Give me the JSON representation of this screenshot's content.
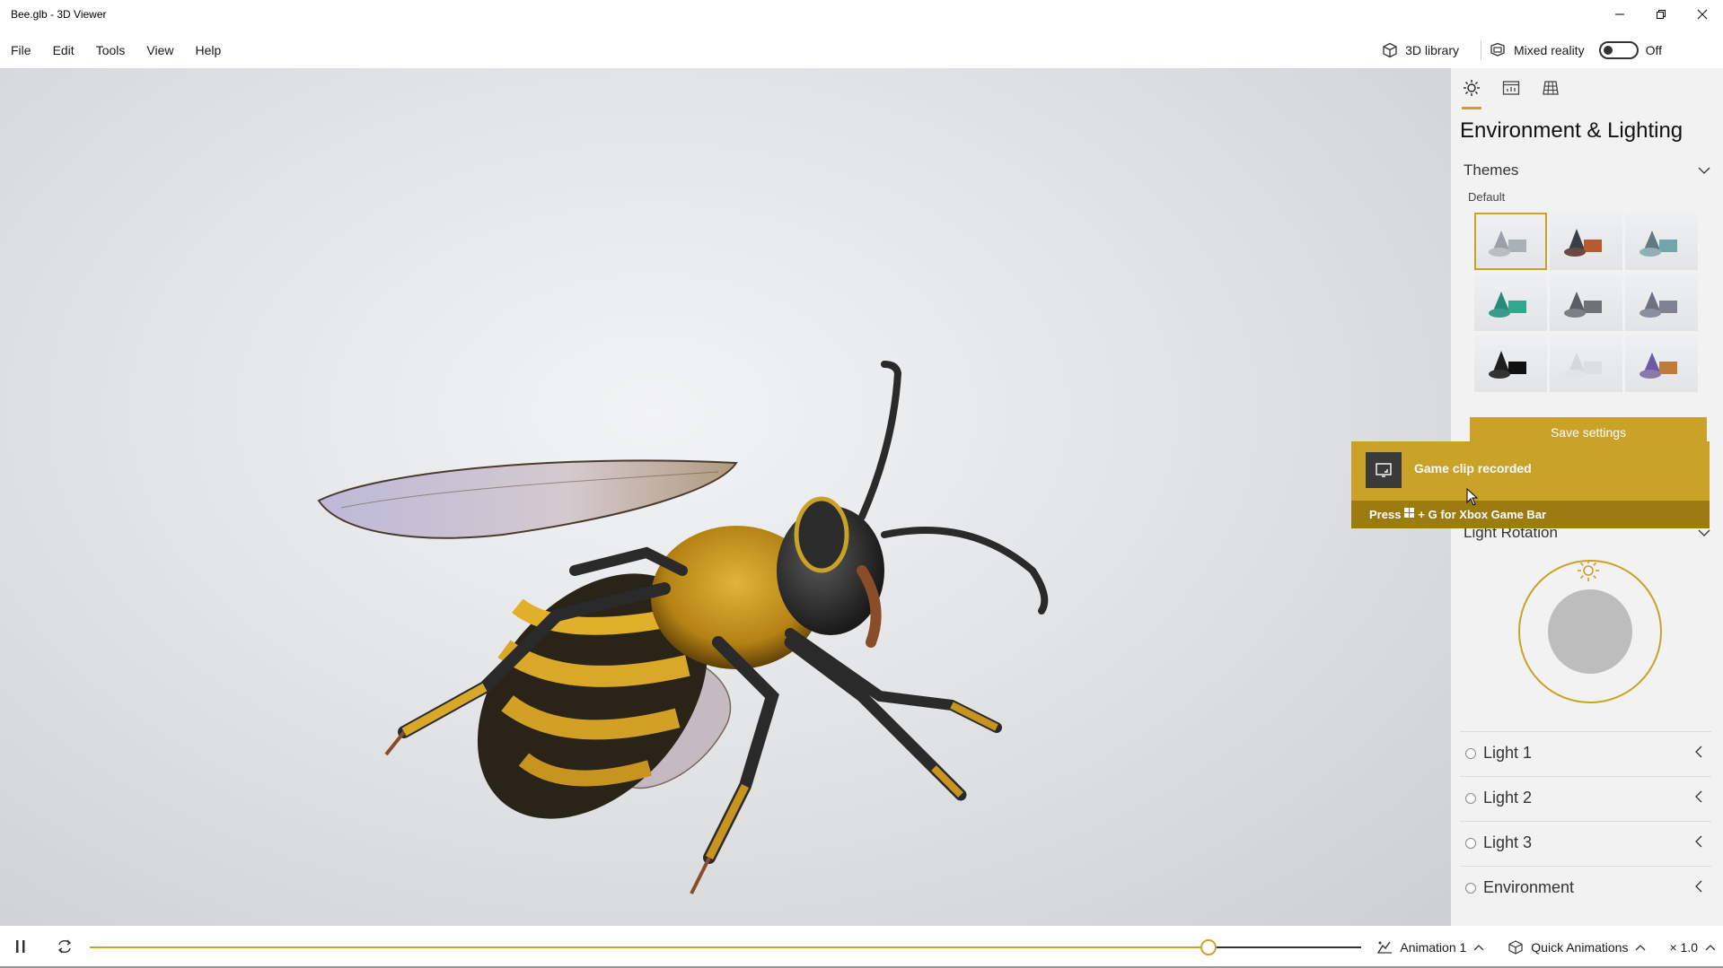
{
  "window": {
    "title": "Bee.glb - 3D Viewer"
  },
  "menu": {
    "items": [
      "File",
      "Edit",
      "Tools",
      "View",
      "Help"
    ]
  },
  "toolbar": {
    "library_label": "3D library",
    "mixed_reality_label": "Mixed reality",
    "mixed_reality_state": "Off"
  },
  "panel": {
    "title": "Environment & Lighting",
    "themes": {
      "label": "Themes",
      "default_label": "Default"
    },
    "save_button": "Save settings",
    "light_rotation_label": "Light Rotation",
    "lights": [
      "Light 1",
      "Light 2",
      "Light 3",
      "Environment"
    ]
  },
  "toast": {
    "title": "Game clip recorded",
    "hint_prefix": "Press",
    "hint_suffix": "+ G for Xbox Game Bar"
  },
  "bottom": {
    "animation_label": "Animation 1",
    "quick_animations_label": "Quick Animations",
    "speed_label": "× 1.0",
    "timeline_progress": 0.88
  },
  "colors": {
    "accent": "#c9a227",
    "toast_dark": "#9c7c10",
    "panel_bg": "#f2f2f2"
  }
}
